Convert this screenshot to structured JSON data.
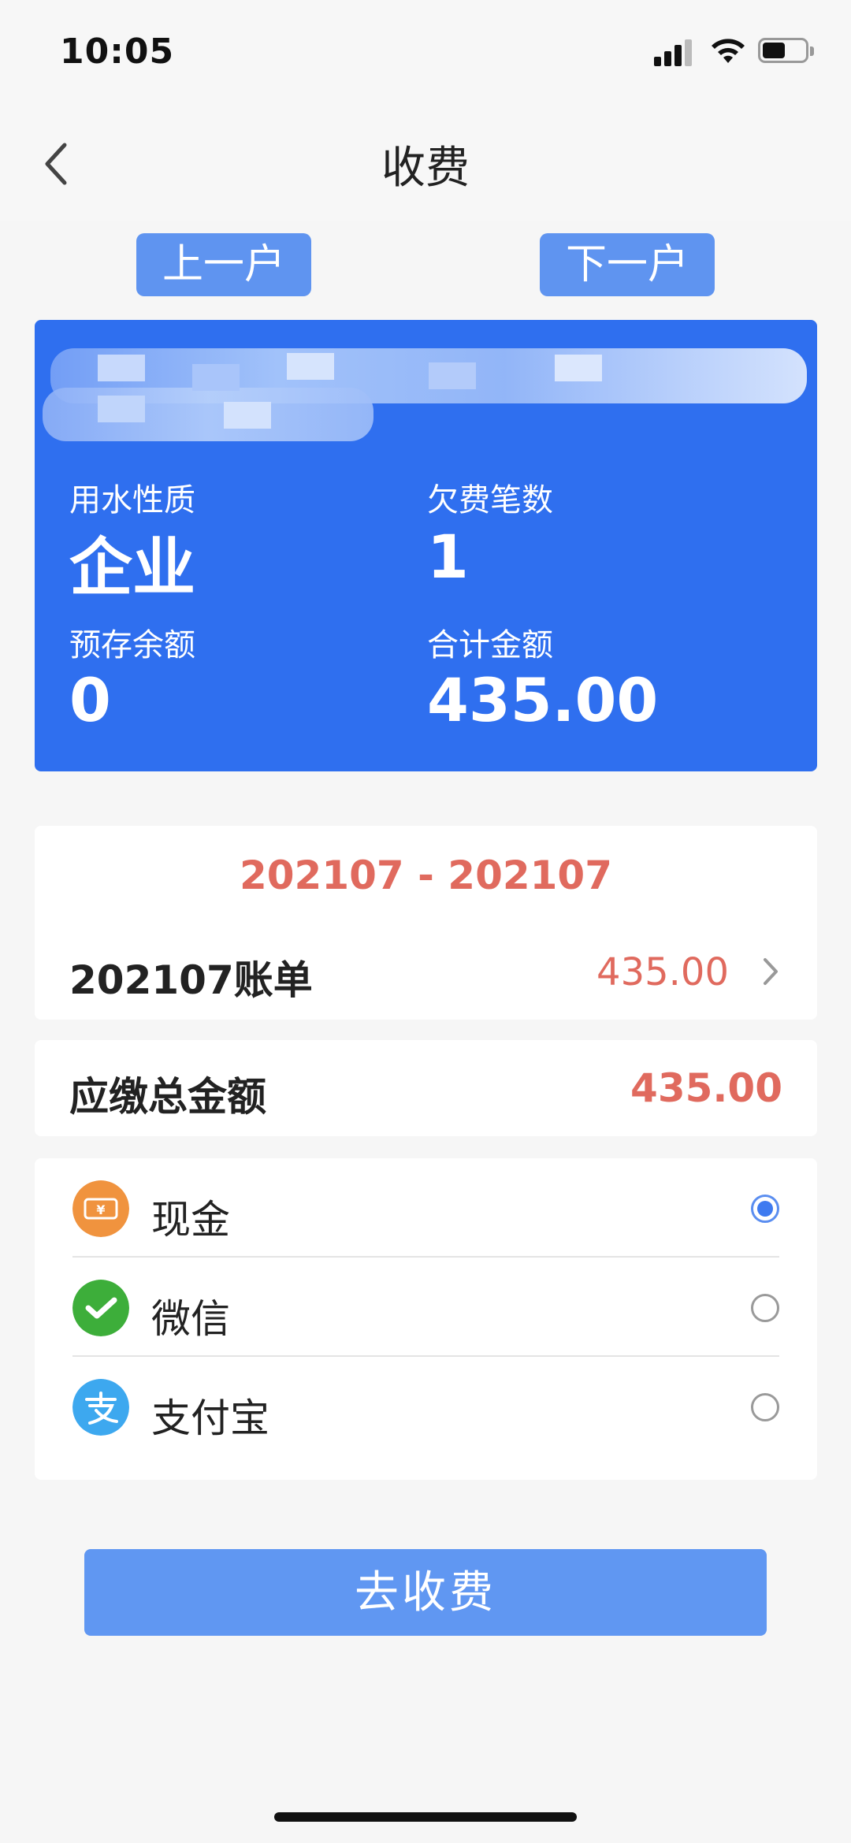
{
  "status_bar": {
    "time": "10:05"
  },
  "nav": {
    "title": "收费"
  },
  "switch": {
    "prev_label": "上一户",
    "next_label": "下一户"
  },
  "card": {
    "nature_label": "用水性质",
    "nature_value": "企业",
    "count_label": "欠费笔数",
    "count_value": "1",
    "deposit_label": "预存余额",
    "deposit_value": "0",
    "total_label": "合计金额",
    "total_value": "435.00"
  },
  "bill": {
    "period": "202107 - 202107",
    "row_label": "202107账单",
    "row_amount": "435.00"
  },
  "summary": {
    "label": "应缴总金额",
    "amount": "435.00"
  },
  "payment": {
    "methods": [
      {
        "label": "现金",
        "icon": "cash-icon",
        "selected": true
      },
      {
        "label": "微信",
        "icon": "wechat-icon",
        "selected": false
      },
      {
        "label": "支付宝",
        "icon": "alipay-icon",
        "selected": false
      }
    ]
  },
  "submit": {
    "label": "去收费"
  },
  "colors": {
    "primary": "#2f6fef",
    "button": "#6097f2",
    "amount_red": "#e06a5e",
    "cash": "#f0933e",
    "wechat": "#3dae3a",
    "alipay": "#3da8ef"
  }
}
